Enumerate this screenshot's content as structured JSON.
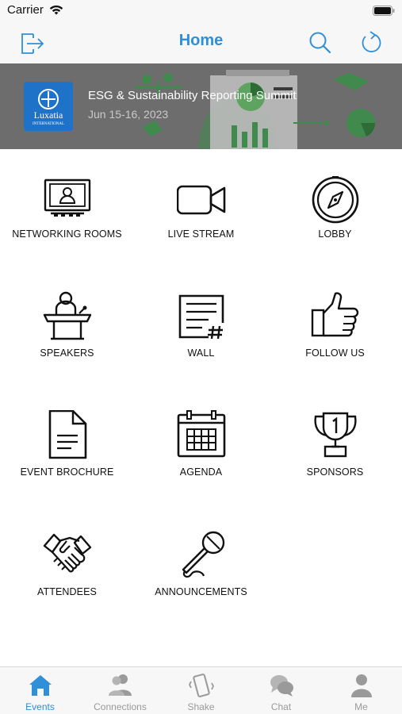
{
  "status_bar": {
    "carrier": "Carrier"
  },
  "nav": {
    "title": "Home",
    "icons": {
      "left": "logout-icon",
      "search": "search-icon",
      "refresh": "refresh-icon"
    }
  },
  "banner": {
    "title": "ESG & Sustainability Reporting Summit",
    "date": "Jun 15-16, 2023",
    "logo_text": "Luxatia",
    "logo_subtext": "INTERNATIONAL"
  },
  "menu": [
    {
      "label": "NETWORKING ROOMS",
      "icon": "presentation-screen-icon"
    },
    {
      "label": "LIVE STREAM",
      "icon": "video-camera-icon"
    },
    {
      "label": "LOBBY",
      "icon": "compass-icon"
    },
    {
      "label": "SPEAKERS",
      "icon": "podium-speaker-icon"
    },
    {
      "label": "WALL",
      "icon": "wall-post-icon"
    },
    {
      "label": "FOLLOW US",
      "icon": "thumbs-up-icon"
    },
    {
      "label": "EVENT BROCHURE",
      "icon": "document-icon"
    },
    {
      "label": "AGENDA",
      "icon": "calendar-icon"
    },
    {
      "label": "SPONSORS",
      "icon": "trophy-icon"
    },
    {
      "label": "ATTENDEES",
      "icon": "handshake-icon"
    },
    {
      "label": "ANNOUNCEMENTS",
      "icon": "microphone-icon"
    }
  ],
  "tabs": [
    {
      "label": "Events",
      "icon": "home-icon",
      "active": true
    },
    {
      "label": "Connections",
      "icon": "people-icon",
      "active": false
    },
    {
      "label": "Shake",
      "icon": "shake-phone-icon",
      "active": false
    },
    {
      "label": "Chat",
      "icon": "chat-bubbles-icon",
      "active": false
    },
    {
      "label": "Me",
      "icon": "person-icon",
      "active": false
    }
  ],
  "colors": {
    "accent": "#2f8fd8",
    "inactive": "#9a9a9a",
    "logo_bg": "#1e73c9"
  }
}
